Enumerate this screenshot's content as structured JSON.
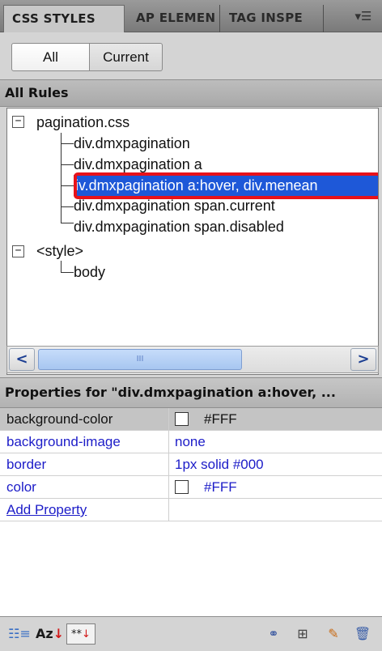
{
  "tabs": [
    {
      "label": "CSS STYLES",
      "active": true
    },
    {
      "label": "AP ELEMEN",
      "active": false
    },
    {
      "label": "TAG INSPE",
      "active": false
    }
  ],
  "panel_menu_icon": "panel-options-icon",
  "mode": {
    "all_label": "All",
    "current_label": "Current",
    "selected": "All"
  },
  "all_rules": {
    "header": "All Rules",
    "tree": [
      {
        "label": "pagination.css",
        "expander": "⊟"
      },
      {
        "label": "div.dmxpagination"
      },
      {
        "label": "div.dmxpagination a"
      },
      {
        "label": "iv.dmxpagination a:hover, div.menean",
        "selected": true
      },
      {
        "label": "div.dmxpagination span.current"
      },
      {
        "label": "div.dmxpagination span.disabled"
      },
      {
        "label": "<style>",
        "expander": "⊟"
      },
      {
        "label": "body"
      }
    ]
  },
  "scrollbar": {
    "left_icon": "<",
    "right_icon": ">",
    "grip": "III"
  },
  "properties": {
    "header": "Properties for \"div.dmxpagination a:hover, ...",
    "rows": [
      {
        "name": "background-color",
        "value": "#FFF",
        "swatch": "#FFFFFF",
        "highlight": true
      },
      {
        "name": "background-image",
        "value": "none"
      },
      {
        "name": "border",
        "value": "1px solid #000"
      },
      {
        "name": "color",
        "value": "#FFF",
        "swatch": "#FFFFFF"
      }
    ],
    "add_property": "Add Property"
  },
  "toolbar": {
    "left_icons": [
      "category-view-icon",
      "alpha-view-icon",
      "set-properties-icon"
    ],
    "alpha_text": "Az",
    "set_text": "**",
    "right_icons": [
      "attach-stylesheet-icon",
      "new-rule-icon",
      "edit-rule-icon",
      "delete-rule-icon"
    ]
  },
  "colors": {
    "selection": "#1e58d8",
    "highlight_outline": "#e8121a",
    "link_blue": "#1c1cc8"
  }
}
